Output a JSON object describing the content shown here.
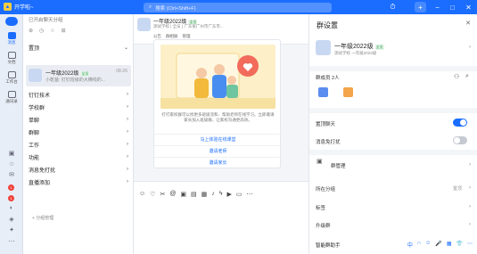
{
  "titlebar": {
    "org_name": "开学啦~",
    "search_placeholder": "搜索 (Ctrl+Shift+F)",
    "buttons": [
      "⏱",
      "+",
      "−",
      "□",
      "✕"
    ]
  },
  "nav": {
    "items": [
      {
        "label": "消息",
        "active": true
      },
      {
        "label": "文档"
      },
      {
        "label": "工作台"
      },
      {
        "label": "通讯录"
      }
    ],
    "badges": [
      "1",
      "1"
    ]
  },
  "list": {
    "header": "已开启聊天分组",
    "categories_top": [
      {
        "label": "置顶"
      }
    ],
    "conversation": {
      "name": "一年级2022级",
      "tag": "全员",
      "message": "小乾爸: 钉钉班级的大横线的...",
      "time": "08-26"
    },
    "categories": [
      {
        "label": "钉钉技术"
      },
      {
        "label": "学校群"
      },
      {
        "label": "单聊"
      },
      {
        "label": "群聊"
      },
      {
        "label": "工作"
      },
      {
        "label": "功能"
      },
      {
        "label": "消息免打扰"
      },
      {
        "label": "直播添加"
      }
    ],
    "add_group": "+ 分组管理"
  },
  "chat": {
    "title": "一年级2022级",
    "tag": "全员",
    "subtitle": "测试学校 | 全员 | 广东省广州市广东市...",
    "tabs": [
      "公告",
      "群相册",
      "管理"
    ],
    "card": {
      "text": "打打家校群可以找更多班级流和、帮助老师在线学习。立即邀请家长加入班级群，让家校沟通更高效。",
      "buttons": [
        "马上体验在线课堂",
        "邀请老师",
        "邀请家长"
      ]
    }
  },
  "panel": {
    "title": "群设置",
    "group_name": "一年级2022级",
    "group_tag": "全员",
    "group_sub": "测试学校  一年级2022级",
    "members_label": "群成员 2人",
    "settings": [
      {
        "label": "置顶聊天",
        "toggle": true
      },
      {
        "label": "消息免打扰",
        "toggle": false
      }
    ],
    "manage": {
      "label": "群管理"
    },
    "rows": [
      {
        "label": "所在分组",
        "value": "置顶"
      },
      {
        "label": "标签",
        "value": ""
      },
      {
        "label": "升级群",
        "value": ""
      }
    ],
    "footer": "智能群助手",
    "footer_tools": [
      "中",
      "∩",
      "☺",
      "🎤",
      "▦",
      "👕",
      "⋯"
    ],
    "colors": {
      "accent": "#1a6dff",
      "toggle_off": "#c5c9d1"
    }
  }
}
